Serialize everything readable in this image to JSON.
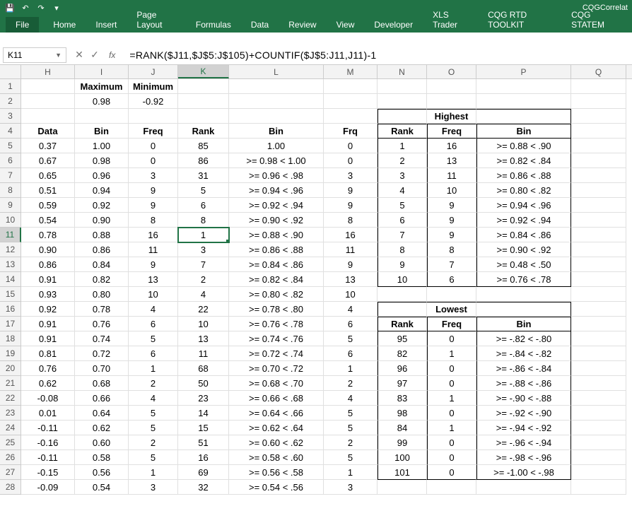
{
  "app": {
    "title_right": "CQGCorrelat"
  },
  "qat": {
    "save": "💾",
    "undo": "↶",
    "redo": "↷",
    "dd": "▾"
  },
  "tabs": [
    "File",
    "Home",
    "Insert",
    "Page Layout",
    "Formulas",
    "Data",
    "Review",
    "View",
    "Developer",
    "XLS Trader",
    "CQG RTD TOOLKIT",
    "CQG STATEM"
  ],
  "namebox": "K11",
  "formula": "=RANK($J11,$J$5:J$105)+COUNTIF($J$5:J11,J11)-1",
  "cols": [
    "H",
    "I",
    "J",
    "K",
    "L",
    "M",
    "N",
    "O",
    "P",
    "Q"
  ],
  "active_col_index": 3,
  "active_row_label": "11",
  "hdr": {
    "maximum": "Maximum",
    "minimum": "Minimum",
    "max_val": "0.98",
    "min_val": "-0.92"
  },
  "labels": {
    "data": "Data",
    "bin": "Bin",
    "freq": "Freq",
    "rank": "Rank",
    "binL": "Bin",
    "frq": "Frq",
    "highest": "Highest",
    "lowest": "Lowest",
    "rankN": "Rank",
    "freqO": "Freq",
    "binP": "Bin"
  },
  "rows": [
    {
      "n": "5",
      "H": "0.37",
      "I": "1.00",
      "J": "0",
      "K": "85",
      "L": "1.00",
      "M": "0",
      "N": "1",
      "O": "16",
      "P": ">= 0.88 < .90"
    },
    {
      "n": "6",
      "H": "0.67",
      "I": "0.98",
      "J": "0",
      "K": "86",
      "L": ">= 0.98 < 1.00",
      "M": "0",
      "N": "2",
      "O": "13",
      "P": ">= 0.82 < .84"
    },
    {
      "n": "7",
      "H": "0.65",
      "I": "0.96",
      "J": "3",
      "K": "31",
      "L": ">= 0.96 < .98",
      "M": "3",
      "N": "3",
      "O": "11",
      "P": ">= 0.86 < .88"
    },
    {
      "n": "8",
      "H": "0.51",
      "I": "0.94",
      "J": "9",
      "K": "5",
      "L": ">= 0.94 < .96",
      "M": "9",
      "N": "4",
      "O": "10",
      "P": ">= 0.80 < .82"
    },
    {
      "n": "9",
      "H": "0.59",
      "I": "0.92",
      "J": "9",
      "K": "6",
      "L": ">= 0.92 < .94",
      "M": "9",
      "N": "5",
      "O": "9",
      "P": ">= 0.94 < .96"
    },
    {
      "n": "10",
      "H": "0.54",
      "I": "0.90",
      "J": "8",
      "K": "8",
      "L": ">= 0.90 < .92",
      "M": "8",
      "N": "6",
      "O": "9",
      "P": ">= 0.92 < .94"
    },
    {
      "n": "11",
      "H": "0.78",
      "I": "0.88",
      "J": "16",
      "K": "1",
      "L": ">= 0.88 < .90",
      "M": "16",
      "N": "7",
      "O": "9",
      "P": ">= 0.84 < .86"
    },
    {
      "n": "12",
      "H": "0.90",
      "I": "0.86",
      "J": "11",
      "K": "3",
      "L": ">= 0.86 < .88",
      "M": "11",
      "N": "8",
      "O": "8",
      "P": ">= 0.90 < .92"
    },
    {
      "n": "13",
      "H": "0.86",
      "I": "0.84",
      "J": "9",
      "K": "7",
      "L": ">= 0.84 < .86",
      "M": "9",
      "N": "9",
      "O": "7",
      "P": ">= 0.48 < .50"
    },
    {
      "n": "14",
      "H": "0.91",
      "I": "0.82",
      "J": "13",
      "K": "2",
      "L": ">= 0.82 < .84",
      "M": "13",
      "N": "10",
      "O": "6",
      "P": ">= 0.76 < .78"
    },
    {
      "n": "15",
      "H": "0.93",
      "I": "0.80",
      "J": "10",
      "K": "4",
      "L": ">= 0.80 < .82",
      "M": "10"
    },
    {
      "n": "16",
      "H": "0.92",
      "I": "0.78",
      "J": "4",
      "K": "22",
      "L": ">= 0.78 < .80",
      "M": "4",
      "low_hdr": true
    },
    {
      "n": "17",
      "H": "0.91",
      "I": "0.76",
      "J": "6",
      "K": "10",
      "L": ">= 0.76 < .78",
      "M": "6",
      "low_labels": true
    },
    {
      "n": "18",
      "H": "0.91",
      "I": "0.74",
      "J": "5",
      "K": "13",
      "L": ">= 0.74 < .76",
      "M": "5",
      "N": "95",
      "O": "0",
      "P": ">= -.82 < -.80"
    },
    {
      "n": "19",
      "H": "0.81",
      "I": "0.72",
      "J": "6",
      "K": "11",
      "L": ">= 0.72 < .74",
      "M": "6",
      "N": "82",
      "O": "1",
      "P": ">= -.84 < -.82"
    },
    {
      "n": "20",
      "H": "0.76",
      "I": "0.70",
      "J": "1",
      "K": "68",
      "L": ">= 0.70 < .72",
      "M": "1",
      "N": "96",
      "O": "0",
      "P": ">= -.86 < -.84"
    },
    {
      "n": "21",
      "H": "0.62",
      "I": "0.68",
      "J": "2",
      "K": "50",
      "L": ">= 0.68 < .70",
      "M": "2",
      "N": "97",
      "O": "0",
      "P": ">= -.88 < -.86"
    },
    {
      "n": "22",
      "H": "-0.08",
      "I": "0.66",
      "J": "4",
      "K": "23",
      "L": ">= 0.66 < .68",
      "M": "4",
      "N": "83",
      "O": "1",
      "P": ">= -.90 < -.88"
    },
    {
      "n": "23",
      "H": "0.01",
      "I": "0.64",
      "J": "5",
      "K": "14",
      "L": ">= 0.64 < .66",
      "M": "5",
      "N": "98",
      "O": "0",
      "P": ">= -.92 < -.90"
    },
    {
      "n": "24",
      "H": "-0.11",
      "I": "0.62",
      "J": "5",
      "K": "15",
      "L": ">= 0.62 < .64",
      "M": "5",
      "N": "84",
      "O": "1",
      "P": ">= -.94 < -.92"
    },
    {
      "n": "25",
      "H": "-0.16",
      "I": "0.60",
      "J": "2",
      "K": "51",
      "L": ">= 0.60 < .62",
      "M": "2",
      "N": "99",
      "O": "0",
      "P": ">= -.96 < -.94"
    },
    {
      "n": "26",
      "H": "-0.11",
      "I": "0.58",
      "J": "5",
      "K": "16",
      "L": ">= 0.58 < .60",
      "M": "5",
      "N": "100",
      "O": "0",
      "P": ">= -.98 < -.96"
    },
    {
      "n": "27",
      "H": "-0.15",
      "I": "0.56",
      "J": "1",
      "K": "69",
      "L": ">= 0.56 < .58",
      "M": "1",
      "N": "101",
      "O": "0",
      "P": ">= -1.00 < -.98"
    },
    {
      "n": "28",
      "H": "-0.09",
      "I": "0.54",
      "J": "3",
      "K": "32",
      "L": ">= 0.54 < .56",
      "M": "3",
      "last_low": true
    }
  ]
}
